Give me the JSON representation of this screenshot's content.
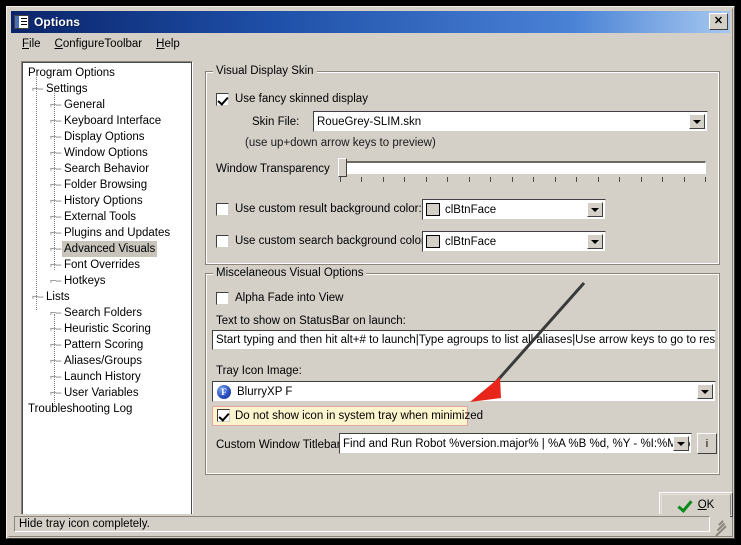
{
  "window": {
    "title": "Options",
    "icon": "options-checklist-icon",
    "close_label": "✕"
  },
  "menu": [
    {
      "label": "File",
      "mnemonic": "F"
    },
    {
      "label": "ConfigureToolbar",
      "mnemonic": "C"
    },
    {
      "label": "Help",
      "mnemonic": "H"
    }
  ],
  "tree": {
    "nodes": [
      {
        "label": "Program Options",
        "level": 0,
        "selected": false
      },
      {
        "label": "Settings",
        "level": 1,
        "selected": false
      },
      {
        "label": "General",
        "level": 2,
        "selected": false
      },
      {
        "label": "Keyboard Interface",
        "level": 2,
        "selected": false
      },
      {
        "label": "Display Options",
        "level": 2,
        "selected": false
      },
      {
        "label": "Window Options",
        "level": 2,
        "selected": false
      },
      {
        "label": "Search Behavior",
        "level": 2,
        "selected": false
      },
      {
        "label": "Folder Browsing",
        "level": 2,
        "selected": false
      },
      {
        "label": "History Options",
        "level": 2,
        "selected": false
      },
      {
        "label": "External Tools",
        "level": 2,
        "selected": false
      },
      {
        "label": "Plugins and Updates",
        "level": 2,
        "selected": false
      },
      {
        "label": "Advanced Visuals",
        "level": 2,
        "selected": true
      },
      {
        "label": "Font Overrides",
        "level": 2,
        "selected": false
      },
      {
        "label": "Hotkeys",
        "level": 2,
        "selected": false
      },
      {
        "label": "Lists",
        "level": 1,
        "selected": false
      },
      {
        "label": "Search Folders",
        "level": 2,
        "selected": false
      },
      {
        "label": "Heuristic Scoring",
        "level": 2,
        "selected": false
      },
      {
        "label": "Pattern Scoring",
        "level": 2,
        "selected": false
      },
      {
        "label": "Aliases/Groups",
        "level": 2,
        "selected": false
      },
      {
        "label": "Launch History",
        "level": 2,
        "selected": false
      },
      {
        "label": "User Variables",
        "level": 2,
        "selected": false
      },
      {
        "label": "Troubleshooting Log",
        "level": 0,
        "selected": false
      }
    ]
  },
  "skin_group": {
    "title": "Visual Display Skin",
    "fancy_skin_label": "Use fancy skinned display",
    "fancy_skin_checked": true,
    "skin_file_label": "Skin File:",
    "skin_file_value": "RoueGrey-SLIM.skn",
    "skin_hint": "(use up+down arrow keys to preview)",
    "transparency_label": "Window Transparency",
    "transparency_value": 0,
    "transparency_ticks": 18,
    "result_color_label": "Use custom result background color:",
    "result_color_checked": false,
    "result_color_value": "clBtnFace",
    "result_color_swatch": "#d4d0c8",
    "search_color_label": "Use custom search background color:",
    "search_color_checked": false,
    "search_color_value": "clBtnFace",
    "search_color_swatch": "#d4d0c8"
  },
  "misc_group": {
    "title": "Miscelaneous Visual Options",
    "alpha_fade_label": "Alpha Fade into View",
    "alpha_fade_checked": false,
    "statusbar_text_label": "Text to show on StatusBar on launch:",
    "statusbar_text_value": "Start typing and then hit alt+# to launch|Type agroups to list all aliases|Use arrow keys to go to results|Hit",
    "tray_icon_label": "Tray Icon Image:",
    "tray_icon_value": "BlurryXP F",
    "tray_icon_glyph": "F",
    "hide_tray_label": "Do not show icon in system tray when minimized",
    "hide_tray_checked": true,
    "hide_tray_highlight_fill": "#fbf4cd",
    "hide_tray_highlight_border": "#e3a5a5",
    "titlebar_label": "Custom Window Titlebar:",
    "titlebar_value": "Find and Run Robot %version.major% | %A %B %d, %Y  -  %I:%M %p",
    "info_button_label": "i"
  },
  "footer": {
    "ok_label": "OK",
    "ok_mnemonic": "O",
    "status_text": "Hide tray icon completely."
  },
  "annotation": {
    "arrow_color": "#3a3a3a",
    "arrowhead_color": "#e8251b",
    "points_to": "hide-tray-checkbox"
  }
}
